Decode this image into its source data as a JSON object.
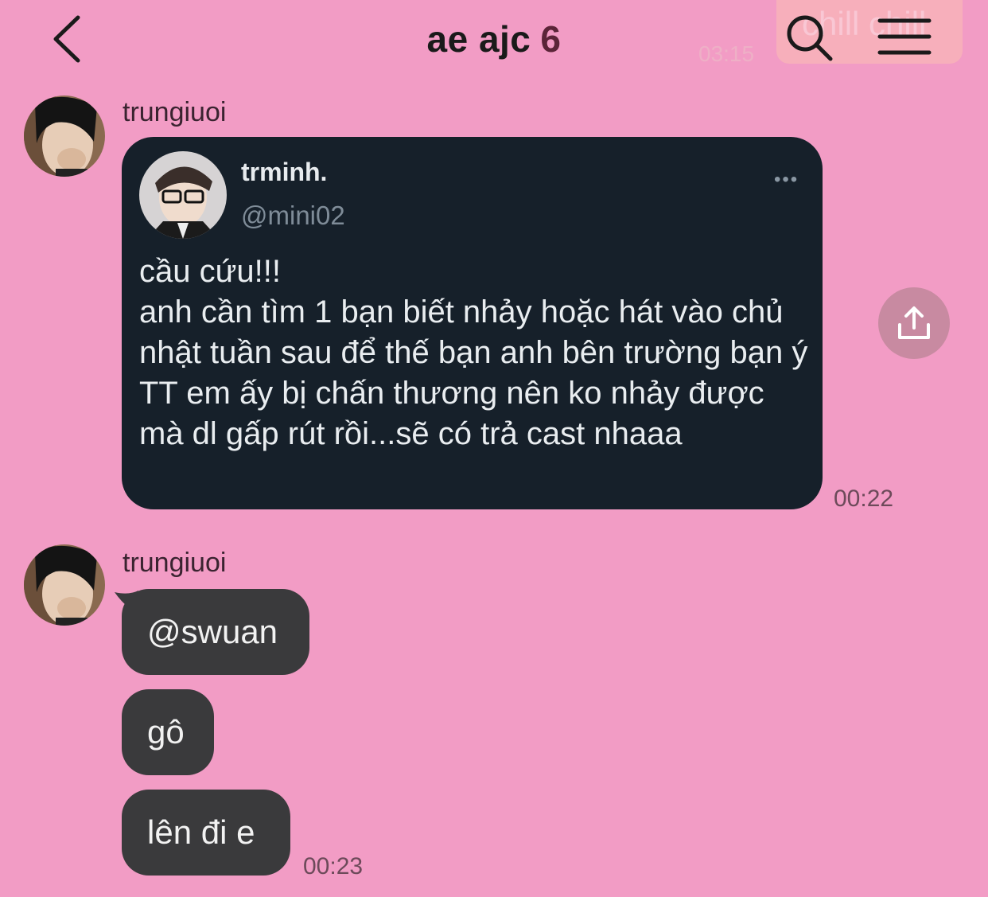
{
  "header": {
    "title": "ae ajc",
    "member_count": "6",
    "back_icon": "chevron-left-icon",
    "search_icon": "search-icon",
    "menu_icon": "hamburger-menu-icon",
    "ghost_label": "chill chill",
    "ghost_time": "03:15"
  },
  "messages": [
    {
      "sender": "trungiuoi",
      "type": "tweet",
      "tweet": {
        "name": "trminh.",
        "handle": "@mini02",
        "more": "•••",
        "text": "cầu cứu!!!\nanh cần tìm 1 bạn biết nhảy hoặc hát vào chủ nhật tuần sau để thế bạn anh bên trường bạn ý TT em ấy bị chấn thương nên ko nhảy được mà dl gấp rút rồi...sẽ có trả cast nhaaa"
      },
      "time": "00:22"
    },
    {
      "sender": "trungiuoi",
      "bubbles": [
        "@swuan",
        "gô",
        "lên đi e"
      ],
      "time": "00:23"
    }
  ],
  "colors": {
    "background": "#f29cc5",
    "bubble": "#3a3a3c",
    "tweet_card": "#16202a",
    "share_button": "#c88aa1"
  }
}
